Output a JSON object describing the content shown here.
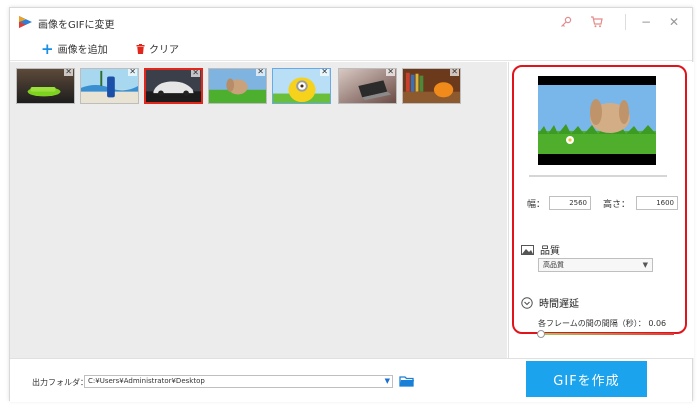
{
  "window": {
    "title": "画像をGIFに変更",
    "controls": {
      "minimize": "−",
      "close": "✕"
    }
  },
  "toolbar": {
    "add_label": "画像を追加",
    "clear_label": "クリア"
  },
  "thumbnails": [
    {
      "icon": "green-sports-car-photo",
      "close": "✕",
      "selected": false
    },
    {
      "icon": "blue-bottle-beach-photo",
      "close": "✕",
      "selected": false
    },
    {
      "icon": "white-car-photo",
      "close": "✕",
      "selected": true
    },
    {
      "icon": "bunny-grass-photo",
      "close": "✕",
      "selected": false
    },
    {
      "icon": "minion-photo",
      "close": "✕",
      "selected": false
    },
    {
      "icon": "laptop-desk-photo",
      "close": "✕",
      "selected": false
    },
    {
      "icon": "bookshelf-pumpkin-photo",
      "close": "✕",
      "selected": false
    }
  ],
  "settings": {
    "width_label": "幅：",
    "width_value": "2560",
    "height_label": "高さ：",
    "height_value": "1600",
    "quality_heading": "品質",
    "quality_value": "高品質",
    "delay_heading": "時間遅延",
    "delay_label": "各フレームの間の間隔（秒）：",
    "delay_value": "0.06"
  },
  "bottom": {
    "output_label": "出力フォルダ：",
    "output_path": "C:¥Users¥Administrator¥Desktop",
    "create_button": "GIFを作成"
  },
  "colors": {
    "accent": "#1ba3ee",
    "highlight_frame": "#e1141c",
    "selected_border": "#e1261c"
  }
}
